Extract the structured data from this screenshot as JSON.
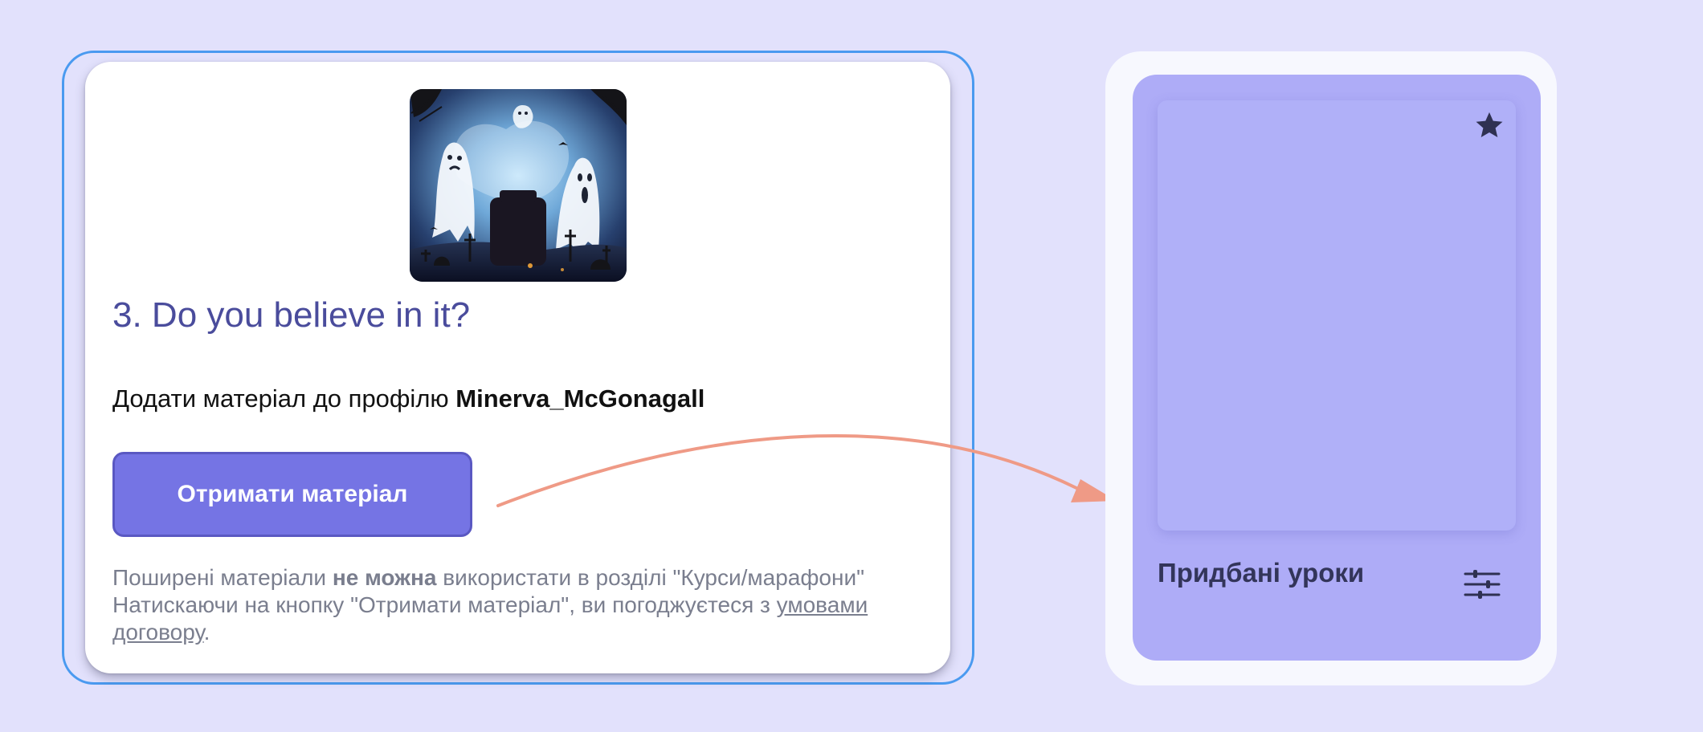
{
  "material_card": {
    "image_alt": "Ghosts over a graveyard",
    "title": "3. Do you believe in it?",
    "add_prefix": "Додати матеріал до профілю ",
    "username": "Minerva_McGonagall",
    "button_label": "Отримати матеріал",
    "note": {
      "part1": "Поширені матеріали ",
      "bold": "не можна",
      "part2": " використати в розділі \"Курси/марафони\"",
      "line2": "Натискаючи на кнопку \"Отримати матеріал\", ви погоджуєтеся з ",
      "link": "умовами договору",
      "end": "."
    }
  },
  "library_card": {
    "label": "Придбані уроки",
    "star_icon": "star-icon",
    "filter_icon": "sliders-icon"
  },
  "colors": {
    "accent": "#7574e4",
    "focus": "#4a9af0",
    "arrow": "#ef9a86",
    "panel": "#aeacf7"
  }
}
